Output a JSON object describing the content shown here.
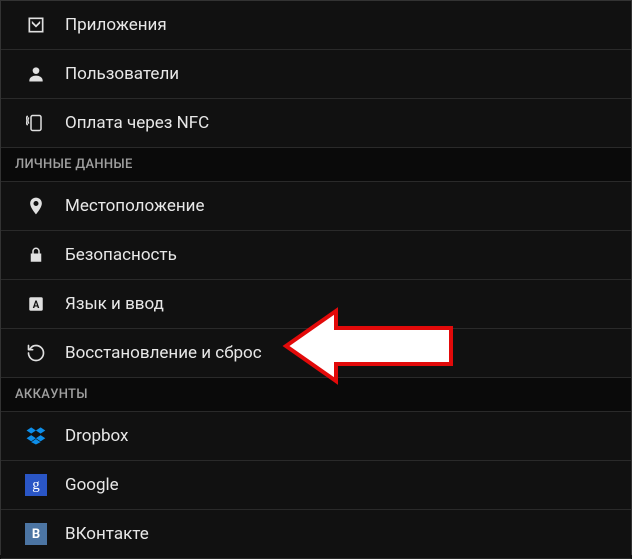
{
  "items": {
    "apps": "Приложения",
    "users": "Пользователи",
    "nfc_payment": "Оплата через NFC"
  },
  "sections": {
    "personal": "ЛИЧНЫЕ ДАННЫЕ",
    "accounts": "АККАУНТЫ"
  },
  "personal": {
    "location": "Местоположение",
    "security": "Безопасность",
    "language": "Язык и ввод",
    "backup_reset": "Восстановление и сброс"
  },
  "accounts": {
    "dropbox": "Dropbox",
    "google": "Google",
    "vkontakte": "ВКонтакте",
    "google_glyph": "g",
    "vk_glyph": "В"
  }
}
